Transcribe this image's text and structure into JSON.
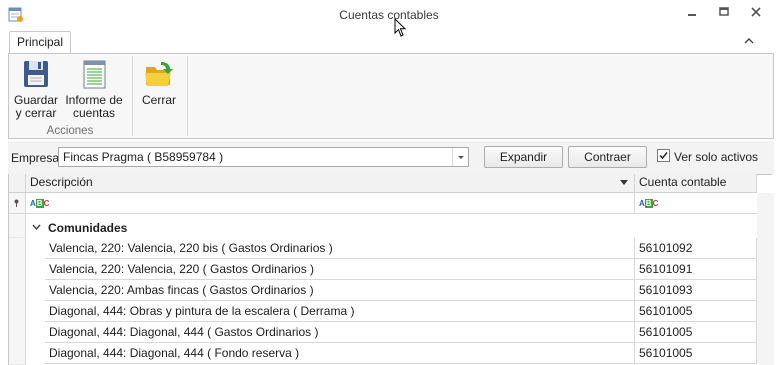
{
  "window": {
    "title": "Cuentas contables",
    "minimize_icon": "minimize-icon",
    "restore_icon": "restore-icon",
    "close_icon": "close-icon"
  },
  "tabs": [
    {
      "label": "Principal",
      "active": true
    }
  ],
  "ribbon": {
    "groups": [
      {
        "label": "Acciones",
        "buttons": [
          {
            "label": "Guardar y cerrar",
            "lines": [
              "Guardar",
              "y cerrar"
            ],
            "icon": "floppy-disk-icon"
          },
          {
            "label": "Informe de cuentas",
            "lines": [
              "Informe de",
              "cuentas"
            ],
            "icon": "report-icon"
          }
        ]
      },
      {
        "label": "",
        "buttons": [
          {
            "label": "Cerrar",
            "lines": [
              "Cerrar"
            ],
            "icon": "folder-icon"
          }
        ]
      }
    ]
  },
  "filter": {
    "empresa_label": "Empresa:",
    "empresa_value": "Fincas Pragma ( B58959784 )",
    "expand_label": "Expandir",
    "collapse_label": "Contraer",
    "show_active_label": "Ver solo activos",
    "show_active_checked": true
  },
  "grid": {
    "columns": [
      "Descripción",
      "Cuenta contable"
    ],
    "group": {
      "label": "Comunidades",
      "expanded": true
    },
    "rows": [
      {
        "descripcion": "Valencia, 220: Valencia, 220 bis ( Gastos Ordinarios )",
        "cuenta": "56101092"
      },
      {
        "descripcion": "Valencia, 220: Valencia, 220 ( Gastos Ordinarios )",
        "cuenta": "56101091"
      },
      {
        "descripcion": "Valencia, 220: Ambas fincas ( Gastos Ordinarios )",
        "cuenta": "56101093"
      },
      {
        "descripcion": "Diagonal, 444: Obras y pintura de la escalera ( Derrama )",
        "cuenta": "56101005"
      },
      {
        "descripcion": "Diagonal, 444: Diagonal, 444 ( Gastos Ordinarios )",
        "cuenta": "56101005"
      },
      {
        "descripcion": "Diagonal, 444: Diagonal, 444 ( Fondo reserva )",
        "cuenta": "56101005"
      }
    ]
  },
  "colors": {
    "accent_green": "#3aa53a",
    "folder_yellow": "#f2c12e",
    "border": "#c6c6c6"
  }
}
